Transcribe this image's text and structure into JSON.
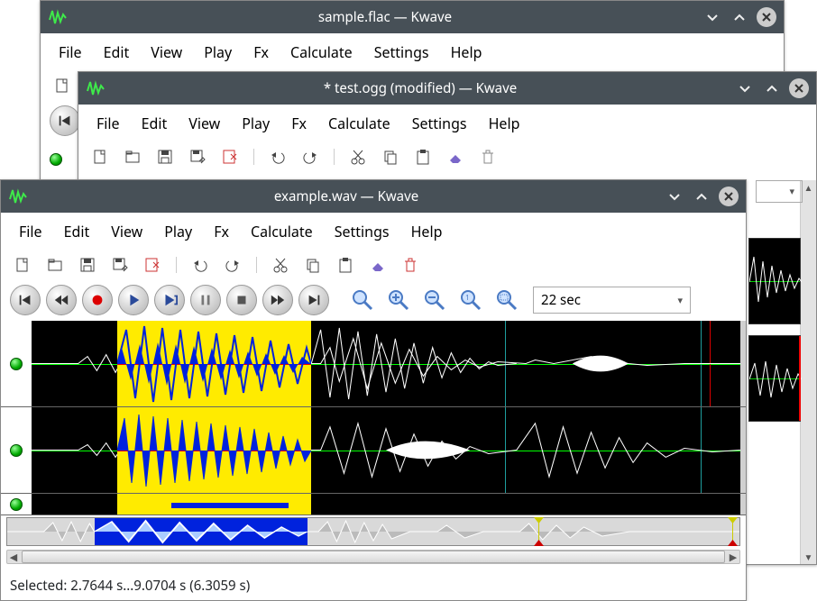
{
  "windows": [
    {
      "title": "sample.flac — Kwave"
    },
    {
      "title": "* test.ogg (modified) — Kwave"
    },
    {
      "title": "example.wav — Kwave"
    }
  ],
  "menu": {
    "file": "File",
    "edit": "Edit",
    "view": "View",
    "play": "Play",
    "fx": "Fx",
    "calculate": "Calculate",
    "settings": "Settings",
    "help": "Help"
  },
  "icons": {
    "new": "new-file",
    "open": "folder-open",
    "save": "save",
    "saveas": "save-as",
    "close": "close-file",
    "undo": "undo",
    "redo": "redo",
    "cut": "cut",
    "copy": "copy",
    "paste": "paste",
    "erase": "erase",
    "delete": "delete"
  },
  "transport": {
    "prev": "skip-back",
    "rew": "rewind",
    "rec": "record",
    "play": "play",
    "loop": "play-loop",
    "pause": "pause",
    "stop": "stop",
    "fwd": "forward",
    "next": "skip-forward"
  },
  "zoom": {
    "fit": "zoom-fit",
    "in": "zoom-in",
    "out": "zoom-out",
    "one": "zoom-1to1",
    "sel": "zoom-selection",
    "value": "22 sec"
  },
  "status": "Selected: 2.7644 s...9.0704 s (6.3059 s)",
  "selection": {
    "start_s": 2.7644,
    "end_s": 9.0704,
    "duration_s": 6.3059
  },
  "accent": {
    "selection_bg": "#ffeb00",
    "selection_wave": "#0022dd"
  }
}
